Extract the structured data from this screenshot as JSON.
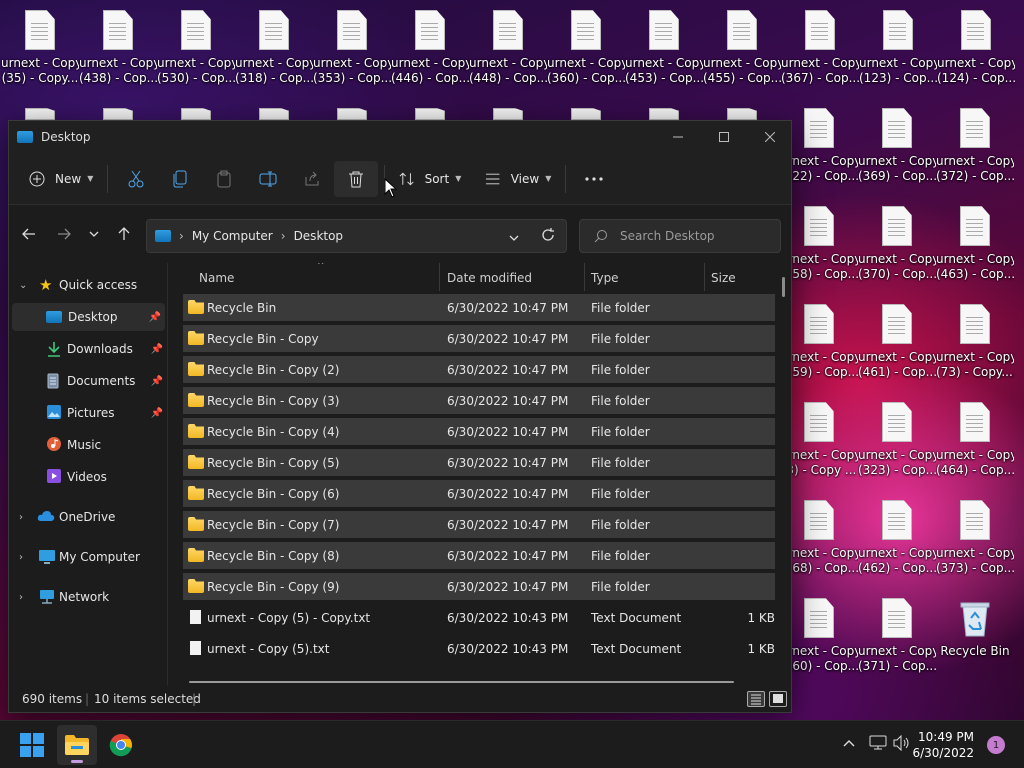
{
  "desktop": {
    "icons_row1": [
      {
        "l1": "urnext - Copy",
        "l2": "(35) - Copy..."
      },
      {
        "l1": "urnext - Copy",
        "l2": "(438) - Cop..."
      },
      {
        "l1": "urnext - Copy",
        "l2": "(530) - Cop..."
      },
      {
        "l1": "urnext - Copy",
        "l2": "(318) - Cop..."
      },
      {
        "l1": "urnext - Copy",
        "l2": "(353) - Cop..."
      },
      {
        "l1": "urnext - Copy",
        "l2": "(446) - Cop..."
      },
      {
        "l1": "urnext - Copy",
        "l2": "(448) - Cop..."
      },
      {
        "l1": "urnext - Copy",
        "l2": "(360) - Cop..."
      },
      {
        "l1": "urnext - Copy",
        "l2": "(453) - Cop..."
      },
      {
        "l1": "urnext - Copy",
        "l2": "(455) - Cop..."
      },
      {
        "l1": "urnext - Copy",
        "l2": "(367) - Cop..."
      },
      {
        "l1": "urnext - Copy",
        "l2": "(123) - Cop..."
      },
      {
        "l1": "urnext - Copy",
        "l2": "(124) - Cop..."
      }
    ],
    "right_col1": [
      {
        "l1": "urnext - Copy",
        "l2": "(322) - Cop..."
      },
      {
        "l1": "urnext - Copy",
        "l2": "(458) - Cop..."
      },
      {
        "l1": "urnext - Copy",
        "l2": "(459) - Cop..."
      },
      {
        "l1": "urnext - Copy",
        "l2": "(3) - Copy ..."
      },
      {
        "l1": "urnext - Copy",
        "l2": "(468) - Cop..."
      },
      {
        "l1": "urnext - Copy",
        "l2": "(460) - Cop..."
      }
    ],
    "right_col2": [
      {
        "l1": "urnext - Copy",
        "l2": "(369) - Cop..."
      },
      {
        "l1": "urnext - Copy",
        "l2": "(370) - Cop..."
      },
      {
        "l1": "urnext - Copy",
        "l2": "(461) - Cop..."
      },
      {
        "l1": "urnext - Copy",
        "l2": "(323) - Cop..."
      },
      {
        "l1": "urnext - Copy",
        "l2": "(462) - Cop..."
      },
      {
        "l1": "urnext - Copy",
        "l2": "(371) - Cop..."
      }
    ],
    "right_col3": [
      {
        "l1": "urnext - Copy",
        "l2": "(372) - Cop..."
      },
      {
        "l1": "urnext - Copy",
        "l2": "(463) - Cop..."
      },
      {
        "l1": "urnext - Copy",
        "l2": "(73) - Copy...."
      },
      {
        "l1": "urnext - Copy",
        "l2": "(464) - Cop..."
      },
      {
        "l1": "urnext - Copy",
        "l2": "(373) - Cop..."
      }
    ],
    "recycle_bin_label": "Recycle Bin"
  },
  "window": {
    "title": "Desktop",
    "commands": {
      "new_label": "New",
      "sort_label": "Sort",
      "view_label": "View",
      "more_label": "..."
    },
    "address": {
      "root": "My Computer",
      "current": "Desktop"
    },
    "search_placeholder": "Search Desktop",
    "sidebar": {
      "quick_access": "Quick access",
      "desktop": "Desktop",
      "downloads": "Downloads",
      "documents": "Documents",
      "pictures": "Pictures",
      "music": "Music",
      "videos": "Videos",
      "onedrive": "OneDrive",
      "my_computer": "My Computer",
      "network": "Network"
    },
    "columns": {
      "name": "Name",
      "date": "Date modified",
      "type": "Type",
      "size": "Size"
    },
    "files": [
      {
        "name": "Recycle Bin",
        "date": "6/30/2022 10:47 PM",
        "type": "File folder",
        "size": "",
        "kind": "folder",
        "selected": true
      },
      {
        "name": "Recycle Bin - Copy",
        "date": "6/30/2022 10:47 PM",
        "type": "File folder",
        "size": "",
        "kind": "folder",
        "selected": true
      },
      {
        "name": "Recycle Bin - Copy (2)",
        "date": "6/30/2022 10:47 PM",
        "type": "File folder",
        "size": "",
        "kind": "folder",
        "selected": true
      },
      {
        "name": "Recycle Bin - Copy (3)",
        "date": "6/30/2022 10:47 PM",
        "type": "File folder",
        "size": "",
        "kind": "folder",
        "selected": true
      },
      {
        "name": "Recycle Bin - Copy (4)",
        "date": "6/30/2022 10:47 PM",
        "type": "File folder",
        "size": "",
        "kind": "folder",
        "selected": true
      },
      {
        "name": "Recycle Bin - Copy (5)",
        "date": "6/30/2022 10:47 PM",
        "type": "File folder",
        "size": "",
        "kind": "folder",
        "selected": true
      },
      {
        "name": "Recycle Bin - Copy (6)",
        "date": "6/30/2022 10:47 PM",
        "type": "File folder",
        "size": "",
        "kind": "folder",
        "selected": true
      },
      {
        "name": "Recycle Bin - Copy (7)",
        "date": "6/30/2022 10:47 PM",
        "type": "File folder",
        "size": "",
        "kind": "folder",
        "selected": true
      },
      {
        "name": "Recycle Bin - Copy (8)",
        "date": "6/30/2022 10:47 PM",
        "type": "File folder",
        "size": "",
        "kind": "folder",
        "selected": true
      },
      {
        "name": "Recycle Bin - Copy (9)",
        "date": "6/30/2022 10:47 PM",
        "type": "File folder",
        "size": "",
        "kind": "folder",
        "selected": true
      },
      {
        "name": "urnext - Copy (5) - Copy.txt",
        "date": "6/30/2022 10:43 PM",
        "type": "Text Document",
        "size": "1 KB",
        "kind": "txt",
        "selected": false
      },
      {
        "name": "urnext - Copy (5).txt",
        "date": "6/30/2022 10:43 PM",
        "type": "Text Document",
        "size": "1 KB",
        "kind": "txt",
        "selected": false
      }
    ],
    "status": {
      "item_count": "690 items",
      "selected_count": "10 items selected"
    }
  },
  "taskbar": {
    "time": "10:49 PM",
    "date": "6/30/2022",
    "notification_count": "1"
  }
}
